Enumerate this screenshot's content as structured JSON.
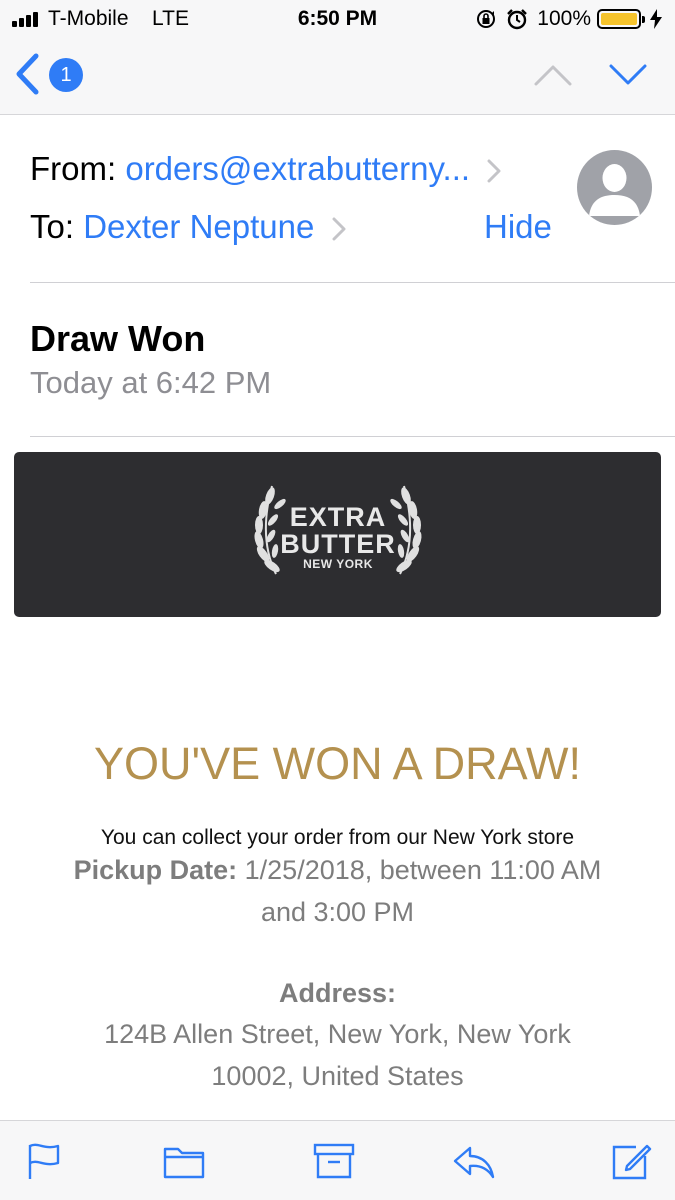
{
  "status_bar": {
    "carrier": "T-Mobile",
    "network": "LTE",
    "time": "6:50 PM",
    "battery_percent": "100%",
    "battery_level": 1.0,
    "icons": [
      "signal-icon",
      "orientation-lock-icon",
      "alarm-icon",
      "battery-icon",
      "charging-icon"
    ]
  },
  "nav": {
    "back_icon": "chevron-left-icon",
    "badge_count": "1",
    "prev_icon": "chevron-up-icon",
    "next_icon": "chevron-down-icon"
  },
  "header": {
    "from_label": "From:",
    "from_value": "orders@extrabutterny...",
    "to_label": "To:",
    "to_value": "Dexter Neptune",
    "hide_label": "Hide",
    "avatar_icon": "person-icon"
  },
  "message": {
    "subject": "Draw Won",
    "date": "Today at 6:42 PM"
  },
  "banner": {
    "logo_line1": "EXTRA",
    "logo_line2": "BUTTER",
    "logo_line3": "NEW YORK"
  },
  "content": {
    "headline": "YOU'VE WON A DRAW!",
    "collect_text": "You can collect your order from our New York store",
    "pickup_label": "Pickup Date:",
    "pickup_value": "1/25/2018, between 11:00 AM and 3:00 PM",
    "address_label": "Address:",
    "address_value": "124B Allen Street, New York, New York 10002, United States"
  },
  "toolbar": {
    "items": [
      "flag-icon",
      "folder-icon",
      "archive-icon",
      "reply-icon",
      "compose-icon"
    ]
  },
  "colors": {
    "accent": "#2f7cf6",
    "headline": "#b4914f",
    "banner": "#2d2d30",
    "muted": "#8e8e93",
    "battery": "#f5c32c"
  }
}
